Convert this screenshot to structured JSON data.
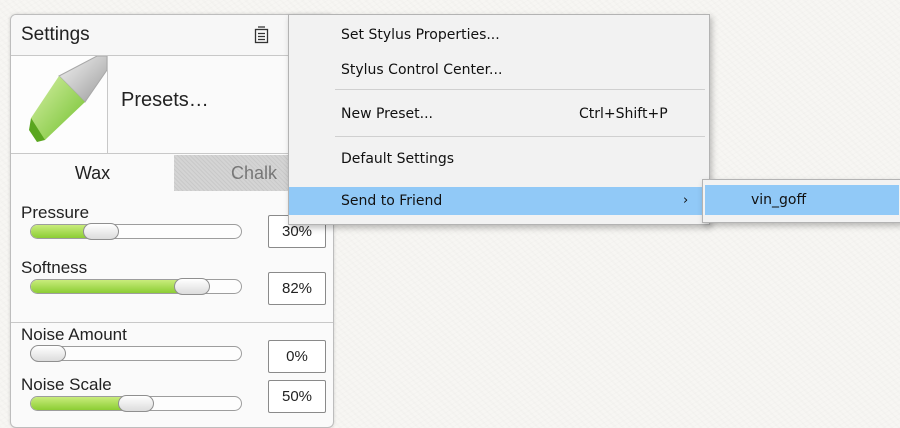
{
  "panel": {
    "title": "Settings",
    "presets_label": "Presets…",
    "tabs": [
      {
        "label": "Wax",
        "selected": true
      },
      {
        "label": "Chalk",
        "selected": false
      }
    ],
    "controls": [
      {
        "label": "Pressure",
        "value": "30%",
        "level": 0.3
      },
      {
        "label": "Softness",
        "value": "82%",
        "level": 0.82
      },
      {
        "label": "Noise Amount",
        "value": "0%",
        "level": 0.0
      },
      {
        "label": "Noise Scale",
        "value": "50%",
        "level": 0.5
      }
    ],
    "accent_color": "#8ccd34"
  },
  "context_menu": {
    "items": [
      {
        "label": "Set Stylus Properties..."
      },
      {
        "label": "Stylus Control Center..."
      },
      {
        "label": "New Preset...",
        "shortcut": "Ctrl+Shift+P"
      },
      {
        "label": "Default Settings"
      },
      {
        "label": "Send to Friend",
        "has_submenu": true,
        "highlighted": true
      }
    ],
    "highlight_color": "#91c9f7"
  },
  "submenu": {
    "items": [
      {
        "label": "vin_goff",
        "highlighted": true
      }
    ]
  }
}
